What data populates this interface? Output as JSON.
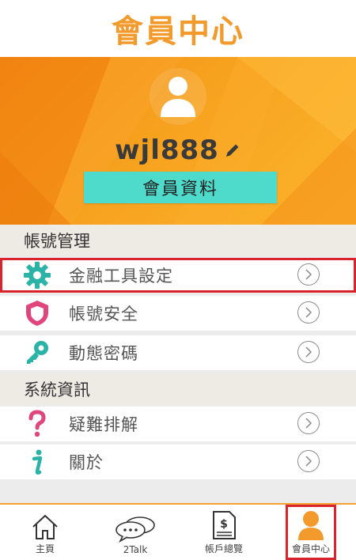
{
  "header": {
    "title": "會員中心"
  },
  "profile": {
    "username": "wjl888",
    "member_button": "會員資料"
  },
  "sections": [
    {
      "title": "帳號管理"
    },
    {
      "title": "系統資訊"
    }
  ],
  "menu": {
    "finance_tools": "金融工具設定",
    "account_security": "帳號安全",
    "dynamic_password": "動態密碼",
    "troubleshooting": "疑難排解",
    "about": "關於"
  },
  "tabs": [
    {
      "label": "主頁",
      "icon": "home-icon"
    },
    {
      "label": "2Talk",
      "icon": "chat-bubbles-icon"
    },
    {
      "label": "帳戶總覽",
      "icon": "document-dollar-icon"
    },
    {
      "label": "會員中心",
      "icon": "user-icon"
    }
  ],
  "colors": {
    "accent": "#f39a2c",
    "teal_button": "#4fdbcc",
    "highlight": "#d9232d",
    "gear": "#2ab3a6",
    "shield": "#e0457b",
    "key": "#2ab3a6",
    "question": "#e0457b",
    "info": "#2ab3a6"
  }
}
